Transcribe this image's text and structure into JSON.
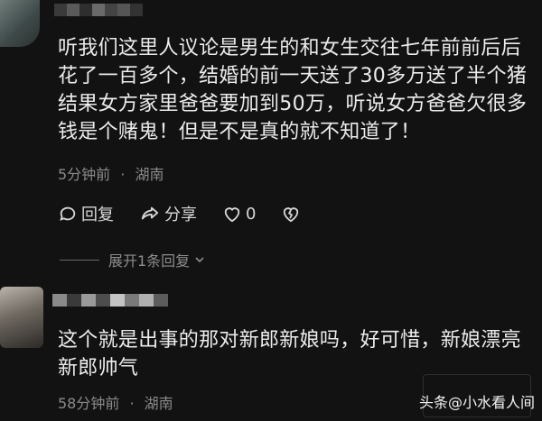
{
  "comments": [
    {
      "text": "听我们这里人议论是男生的和女生交往七年前前后后花了一百多个，结婚的前一天送了30多万送了半个猪结果女方家里爸爸要加到50万，听说女方爸爸欠很多钱是个赌鬼！但是不是真的就不知道了！",
      "time": "5分钟前",
      "location": "湖南"
    },
    {
      "text": "这个就是出事的那对新郎新娘吗，好可惜，新娘漂亮新郎帅气",
      "time": "58分钟前",
      "location": "湖南"
    }
  ],
  "separator": "·",
  "actions": {
    "reply_label": "回复",
    "share_label": "分享",
    "like_count": "0"
  },
  "expand_label": "展开1条回复",
  "watermark": {
    "prefix": "头条",
    "handle": "@小水看人间"
  },
  "colors": {
    "background": "#121212",
    "text": "#ececec",
    "meta": "#8b8b8b"
  }
}
